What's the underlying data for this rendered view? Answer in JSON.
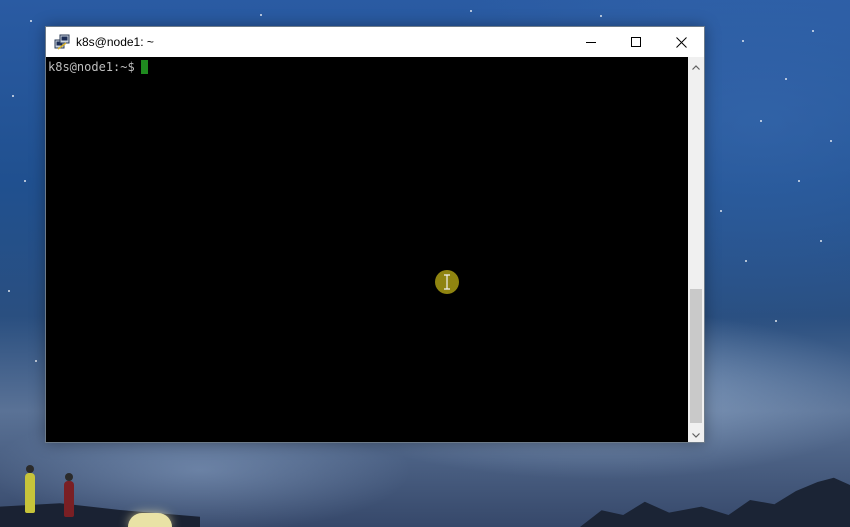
{
  "window": {
    "title": "k8s@node1: ~",
    "controls": {
      "minimize": "minimize",
      "maximize": "maximize",
      "close": "close"
    }
  },
  "terminal": {
    "prompt": "k8s@node1:~$",
    "input": "",
    "cursor_color": "#1f8a1f",
    "background": "#000000",
    "text_color": "#bfbfbf"
  },
  "scrollbar": {
    "position": 1.0
  },
  "icons": {
    "app": "putty-icon",
    "pointer": "ibeam-icon"
  }
}
